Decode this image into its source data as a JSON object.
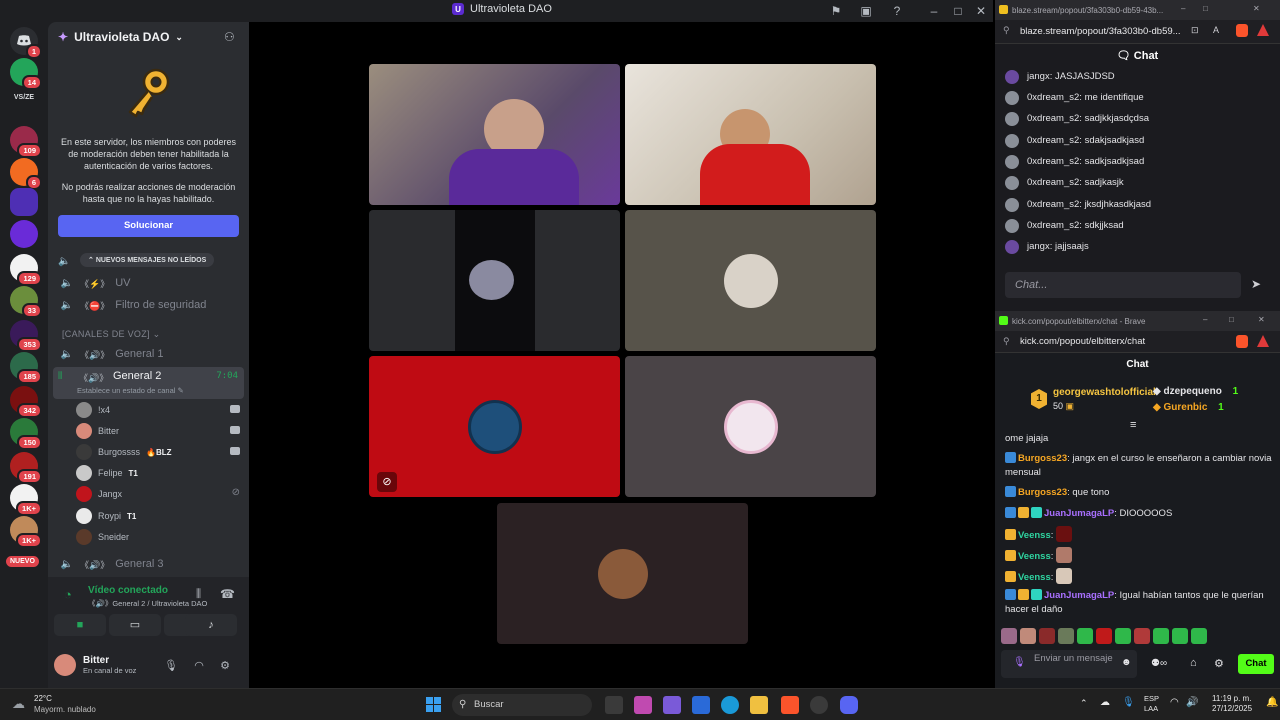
{
  "discord": {
    "window_title": "Ultravioleta DAO",
    "server_name": "Ultravioleta DAO",
    "rail_badges": [
      "1",
      "14",
      "109",
      "6",
      "129",
      "33",
      "353",
      "185",
      "342",
      "150",
      "191",
      "1K+",
      "1K+"
    ],
    "new_label": "NUEVO",
    "mfa_text_1": "En este servidor, los miembros con poderes de moderación deben tener habilitada la autenticación de varios factores.",
    "mfa_text_2": "No podrás realizar acciones de moderación hasta que no la hayas habilitado.",
    "solve_button": "Solucionar",
    "unread_pill": "NUEVOS MENSAJES NO LEÍDOS",
    "channels": [
      {
        "name": "UV",
        "emoji": "《⚡》"
      },
      {
        "name": "Filtro de seguridad",
        "emoji": "《⛔》"
      }
    ],
    "voice_category": "[CANALES DE VOZ]",
    "voice_channels": [
      {
        "name": "General 1",
        "emoji": "《🔊》"
      },
      {
        "name": "General 2",
        "emoji": "《🔊》",
        "timer": "7:04",
        "status": "Establece un estado de canal"
      },
      {
        "name": "General 3",
        "emoji": "《🔊》"
      }
    ],
    "members": [
      {
        "name": "!x4",
        "tag": ""
      },
      {
        "name": "Bitter",
        "tag": ""
      },
      {
        "name": "Burgossss",
        "tag": "🔥BLZ"
      },
      {
        "name": "Felipe",
        "tag": "T1"
      },
      {
        "name": "Jangx",
        "tag": ""
      },
      {
        "name": "Roypi",
        "tag": "T1"
      },
      {
        "name": "Sneider",
        "tag": ""
      }
    ],
    "voice_panel": {
      "title": "Vídeo conectado",
      "sub": "《🔊》General 2 / Ultravioleta DAO"
    },
    "user": {
      "name": "Bitter",
      "status": "En canal de voz"
    }
  },
  "blaze": {
    "tab_title": "blaze.stream/popout/3fa303b0-db59-43b...",
    "url": "blaze.stream/popout/3fa303b0-db59...",
    "header": "Chat",
    "messages": [
      {
        "user": "jangx",
        "text": "JASJASJDSD"
      },
      {
        "user": "0xdream_s2",
        "text": "me identifique"
      },
      {
        "user": "0xdream_s2",
        "text": "sadjkkjasdçdsa"
      },
      {
        "user": "0xdream_s2",
        "text": "sdakjsadkjasd"
      },
      {
        "user": "0xdream_s2",
        "text": "sadkjsadkjsad"
      },
      {
        "user": "0xdream_s2",
        "text": "sadjkasjk"
      },
      {
        "user": "0xdream_s2",
        "text": "jksdjhkasdkjasd"
      },
      {
        "user": "0xdream_s2",
        "text": "sdkjjksad"
      },
      {
        "user": "jangx",
        "text": "jajjsaajs"
      }
    ],
    "input_placeholder": "Chat..."
  },
  "kick": {
    "tab_title": "kick.com/popout/elbitterx/chat - Brave",
    "url": "kick.com/popout/elbitterx/chat",
    "header": "Chat",
    "top_gifter": {
      "rank": "1",
      "name": "georgewashtolofficial",
      "amount": "50"
    },
    "gifters": [
      {
        "name": "dzepequeno",
        "amount": "1"
      },
      {
        "name": "Gurenbic",
        "amount": "1"
      }
    ],
    "messages": [
      {
        "user": "",
        "text": "ome jajaja"
      },
      {
        "user": "Burgoss23",
        "text": ": jangx en el curso le enseñaron a cambiar novia mensual"
      },
      {
        "user": "Burgoss23",
        "text": ": que tono"
      },
      {
        "user": "JuanJumagaLP",
        "text": ": DIOOOOOS"
      },
      {
        "user": "Veenss",
        "text": ":"
      },
      {
        "user": "Veenss",
        "text": ":"
      },
      {
        "user": "Veenss",
        "text": ":"
      },
      {
        "user": "JuanJumagaLP",
        "text": ": Igual habían tantos que le querían hacer el daño"
      }
    ],
    "input_placeholder": "Enviar un mensaje",
    "send_button": "Chat",
    "colors": {
      "burgoss": "#f5a623",
      "juan": "#a970ff",
      "veenss": "#2fd4a0",
      "accent": "#53fc18"
    }
  },
  "taskbar": {
    "weather_temp": "22°C",
    "weather_desc": "Mayorm. nublado",
    "search_placeholder": "Buscar",
    "lang": "ESP",
    "lang2": "LAA",
    "time": "11:19 p. m.",
    "date": "27/12/2025"
  }
}
